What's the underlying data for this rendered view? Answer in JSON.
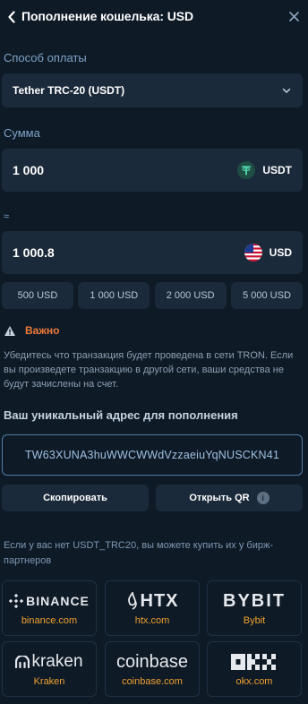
{
  "header": {
    "title": "Пополнение кошелька: USD"
  },
  "payment": {
    "label": "Способ оплаты",
    "selected": "Tether TRC-20 (USDT)"
  },
  "amount": {
    "label": "Сумма",
    "value": "1 000",
    "currency": "USDT"
  },
  "converted": {
    "approx_sign": "≈",
    "value": "1 000.8",
    "currency": "USD"
  },
  "presets": [
    "500 USD",
    "1 000 USD",
    "2 000 USD",
    "5 000 USD"
  ],
  "warning": {
    "title": "Важно",
    "text": "Убедитесь что транзакция будет проведена в сети TRON. Если вы произведете транзакцию в другой сети, ваши средства не будут зачислены на счет."
  },
  "address": {
    "label": "Ваш уникальный адрес для пополнения",
    "value": "TW63XUNA3huWWCWWdVzzaeiuYqNUSCKN41"
  },
  "actions": {
    "copy_label": "Скопировать",
    "qr_label": "Открыть QR"
  },
  "buy": {
    "text": "Если у вас нет USDT_TRC20, вы можете купить их у бирж-партнеров"
  },
  "exchanges": [
    {
      "logo_text": "BINANCE",
      "name": "binance.com",
      "icon": "binance-logo"
    },
    {
      "logo_text": "HTX",
      "name": "htx.com",
      "icon": "htx-logo"
    },
    {
      "logo_text": "BYBIT",
      "name": "Bybit",
      "icon": "bybit-logo"
    },
    {
      "logo_text": "kraken",
      "name": "Kraken",
      "icon": "kraken-logo"
    },
    {
      "logo_text": "coinbase",
      "name": "coinbase.com",
      "icon": "coinbase-logo"
    },
    {
      "logo_text": "OKX",
      "name": "okx.com",
      "icon": "okx-logo"
    }
  ],
  "colors": {
    "background": "#0e1a26",
    "field": "#1b2a3a",
    "label": "#7fa3c7",
    "warning": "#f07a3a",
    "exchange_name": "#f0a030",
    "tether": "#26a17b"
  }
}
